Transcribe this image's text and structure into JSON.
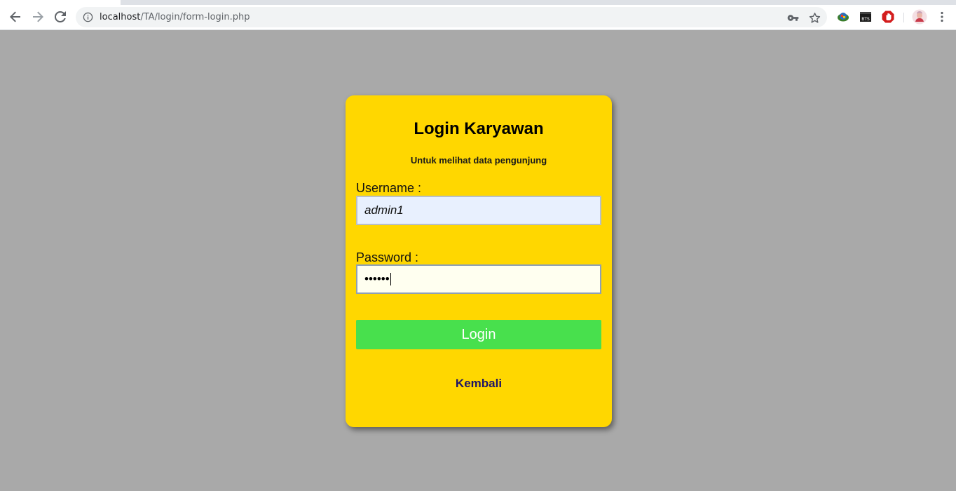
{
  "browser": {
    "url_host": "localhost",
    "url_path": "/TA/login/form-login.php",
    "icons": {
      "back": "arrow-left-icon",
      "forward": "arrow-right-icon",
      "reload": "reload-icon",
      "info": "info-icon",
      "key": "key-icon",
      "bookmark": "star-icon",
      "menu": "more-vert-icon"
    },
    "extensions": [
      "globe-extension-icon",
      "bts-extension-icon",
      "adblock-extension-icon",
      "profile-avatar-icon"
    ],
    "extension_texts": {
      "bts": "BTS"
    }
  },
  "login": {
    "title": "Login Karyawan",
    "subtitle": "Untuk melihat data pengunjung",
    "username_label": "Username :",
    "username_value": "admin1",
    "password_label": "Password :",
    "password_value": "••••••",
    "login_button": "Login",
    "back_link": "Kembali"
  },
  "colors": {
    "page_background": "#a9a9a9",
    "card_background": "#ffd700",
    "login_button": "#48e04d",
    "username_field": "#e8f0fe",
    "password_field": "#fffff0",
    "back_link": "#1d1467"
  }
}
